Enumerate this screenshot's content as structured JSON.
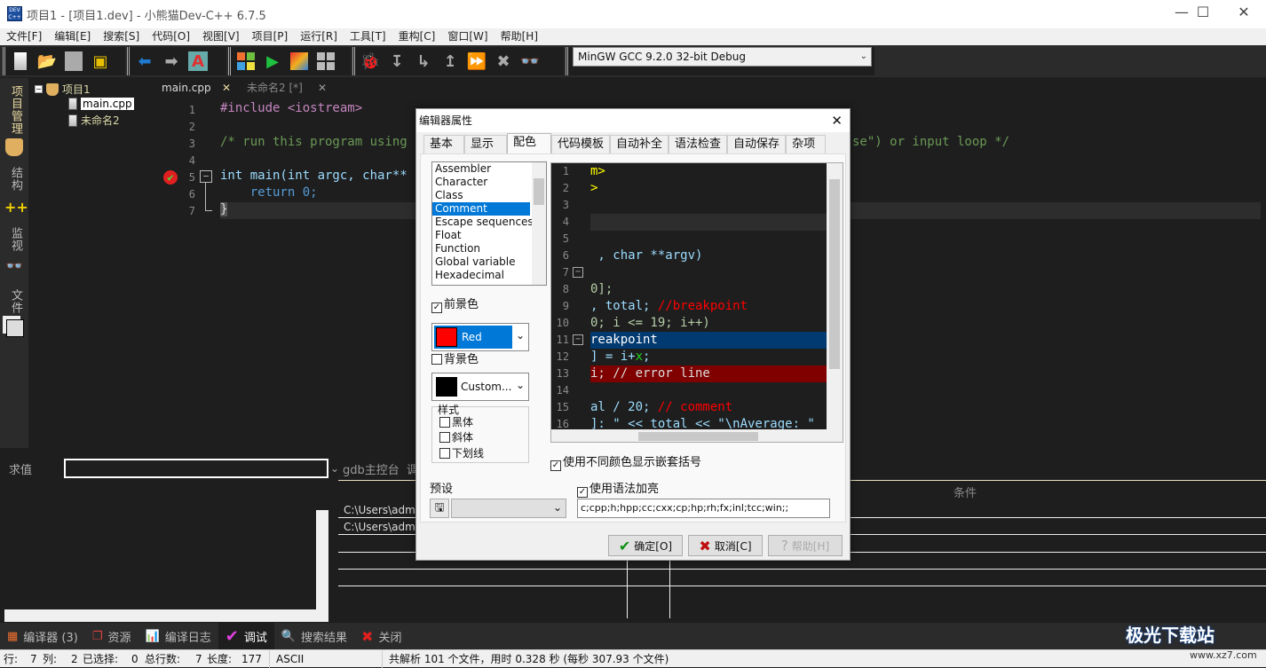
{
  "window": {
    "title": "项目1 - [项目1.dev] - 小熊猫Dev-C++ 6.7.5",
    "app_icon": "DEV C++",
    "controls": {
      "minimize": "—",
      "maximize": "☐",
      "close": "✕"
    }
  },
  "menu": [
    "文件[F]",
    "编辑[E]",
    "搜索[S]",
    "代码[O]",
    "视图[V]",
    "项目[P]",
    "运行[R]",
    "工具[T]",
    "重构[C]",
    "窗口[W]",
    "帮助[H]"
  ],
  "toolbar": {
    "compiler_select": "MinGW GCC 9.2.0 32-bit Debug"
  },
  "left_tabs": [
    "项目管理",
    "结构",
    "监视",
    "文件"
  ],
  "project_tree": {
    "root": "项目1",
    "files": [
      "main.cpp",
      "未命名2"
    ]
  },
  "editor": {
    "tabs": [
      {
        "label": "main.cpp",
        "close": "✕"
      },
      {
        "label": "未命名2 [*]",
        "close": "✕"
      }
    ],
    "lines": [
      "#include <iostream>",
      "",
      "/* run this program using",
      "",
      "int main(int argc, char**",
      "    return 0;",
      "}"
    ],
    "line3_tail": "se\") or input loop */"
  },
  "debug": {
    "eval_label": "求值",
    "gdb_tab": "gdb主控台",
    "gdb_tab2": "调",
    "paths": [
      "C:\\Users\\admin",
      "C:\\Users\\admin"
    ],
    "condition_header": "条件"
  },
  "bottom_tabs": [
    {
      "label": "编译器 (3)",
      "icon": "grid-icon"
    },
    {
      "label": "资源",
      "icon": "resource-icon"
    },
    {
      "label": "编译日志",
      "icon": "bar-chart-icon"
    },
    {
      "label": "调试",
      "icon": "check-icon"
    },
    {
      "label": "搜索结果",
      "icon": "search-icon"
    },
    {
      "label": "关闭",
      "icon": "close-icon"
    }
  ],
  "status": {
    "row_label": "行:",
    "row": "7",
    "col_label": "列:",
    "col": "2",
    "sel_label": "已选择:",
    "sel": "0",
    "total_label": "总行数:",
    "total": "7",
    "len_label": "长度:",
    "len": "177",
    "encoding": "ASCII",
    "message": "共解析 101 个文件，用时 0.328 秒 (每秒 307.93 个文件)"
  },
  "dialog": {
    "title": "编辑器属性",
    "close": "✕",
    "tabs": [
      "基本",
      "显示",
      "配色",
      "代码模板",
      "自动补全",
      "语法检查",
      "自动保存",
      "杂项"
    ],
    "active_tab": "配色",
    "items": [
      "Assembler",
      "Character",
      "Class",
      "Comment",
      "Escape sequences",
      "Float",
      "Function",
      "Global variable",
      "Hexadecimal"
    ],
    "selected_item": "Comment",
    "foreground_label": "前景色",
    "foreground_checked": true,
    "foreground_value": "Red",
    "foreground_color": "#ff0000",
    "background_label": "背景色",
    "background_checked": false,
    "background_value": "Custom...",
    "background_color": "#000000",
    "style_label": "样式",
    "styles": [
      "黑体",
      "斜体",
      "下划线"
    ],
    "preview_lines": [
      "m>",
      ">",
      "",
      "",
      "",
      " , char **argv)",
      "",
      "0];",
      ", total; //breakpoint",
      "0; i <= 19; i++)",
      "reakpoint",
      "] = i+x;",
      "i; // error line",
      "",
      "al / 20; // comment",
      "]: \" << total << \"\\nAverage: \""
    ],
    "nested_brackets_label": "使用不同颜色显示嵌套括号",
    "nested_brackets_checked": true,
    "preset_label": "预设",
    "syntax_label": "使用语法加亮",
    "syntax_checked": true,
    "extensions": "c;cpp;h;hpp;cc;cxx;cp;hp;rh;fx;inl;tcc;win;;",
    "ok": "确定[O]",
    "cancel": "取消[C]",
    "help": "帮助[H]"
  },
  "watermark": {
    "text": "极光下载站",
    "url": "www.xz7.com"
  }
}
